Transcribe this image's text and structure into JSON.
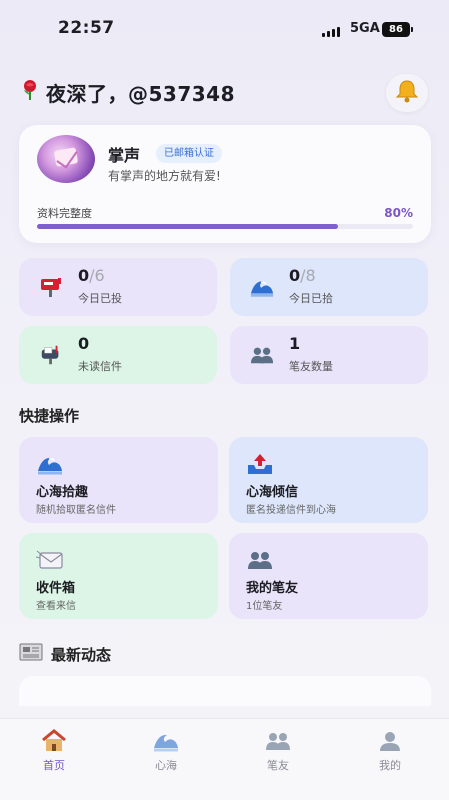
{
  "status": {
    "time": "22:57",
    "network": "5GA",
    "battery": "86"
  },
  "header": {
    "greeting_icon": "rose-icon",
    "greeting": "夜深了，@537348",
    "bell_icon": "bell-icon"
  },
  "profile": {
    "name": "掌声",
    "badge": "已邮箱认证",
    "motto": "有掌声的地方就有爱!",
    "completeness_label": "资料完整度",
    "completeness_value": "80%",
    "completeness_fraction": 0.8
  },
  "stats": [
    {
      "icon": "mailbox-icon",
      "value": "0",
      "total": "/6",
      "label": "今日已投",
      "bg": "#e9e4fa"
    },
    {
      "icon": "wave-icon",
      "value": "0",
      "total": "/8",
      "label": "今日已拾",
      "bg": "#dde6fb"
    },
    {
      "icon": "open-mailbox-icon",
      "value": "0",
      "total": "",
      "label": "未读信件",
      "bg": "#dcf5e6"
    },
    {
      "icon": "people-icon",
      "value": "1",
      "total": "",
      "label": "笔友数量",
      "bg": "#e9e4fa"
    }
  ],
  "quick_actions": {
    "title": "快捷操作",
    "items": [
      {
        "icon": "wave-icon",
        "title": "心海拾趣",
        "desc": "随机拾取匿名信件",
        "bg": "#e9e4fa"
      },
      {
        "icon": "outbox-tray-icon",
        "title": "心海倾信",
        "desc": "匿名投递信件到心海",
        "bg": "#dde6fb"
      },
      {
        "icon": "incoming-envelope-icon",
        "title": "收件箱",
        "desc": "查看来信",
        "bg": "#dcf5e6"
      },
      {
        "icon": "people-icon",
        "title": "我的笔友",
        "desc": "1位笔友",
        "bg": "#e9e4fa"
      }
    ]
  },
  "latest": {
    "title": "最新动态",
    "icon": "newspaper-icon"
  },
  "tabs": [
    {
      "icon": "home-icon",
      "label": "首页",
      "active": true
    },
    {
      "icon": "wave-icon",
      "label": "心海",
      "active": false
    },
    {
      "icon": "people-icon",
      "label": "笔友",
      "active": false
    },
    {
      "icon": "person-icon",
      "label": "我的",
      "active": false
    }
  ],
  "colors": {
    "accent": "#7556c4",
    "progress": "#8060cc",
    "badge_text": "#3a6fd8"
  }
}
